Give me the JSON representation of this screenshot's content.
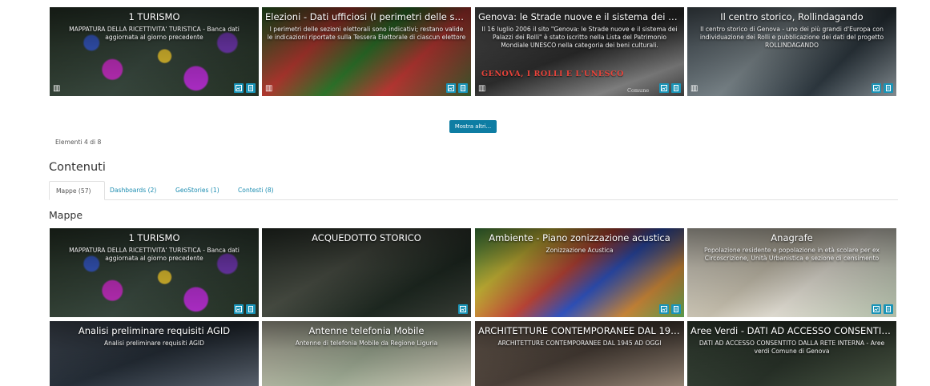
{
  "featured": [
    {
      "title": "1 TURISMO",
      "desc": "MAPPATURA DELLA RICETTIVITA' TURISTICA - Banca dati aggiornata al giorno precedente",
      "theme": "tourism"
    },
    {
      "title": "Elezioni - Dati ufficiosi (I perimetri delle sezioni ...",
      "desc": "I perimetri delle sezioni elettorali sono indicativi; restano valide le indicazioni riportate sulla Tessera Elettorale di ciascun elettore",
      "theme": "elections"
    },
    {
      "title": "Genova: le Strade nuove e il sistema dei Palazzi...",
      "desc": "Il 16 luglio 2006 il sito \"Genova: le Strade nuove e il sistema dei Palazzi dei Rolli\" è stato iscritto nella Lista del Patrimonio Mondiale UNESCO nella categoria dei beni culturali.",
      "theme": "unesco",
      "banner": "GENOVA, I ROLLI E L'UNESCO",
      "banner_sub": "Comune"
    },
    {
      "title": "Il centro storico, Rollindagando",
      "desc": "Il centro storico di Genova - uno dei più grandi d'Europa con individuazione dei Rolli e pubblicazione dei dati del progetto ROLLINDAGANDO",
      "theme": "aerial"
    }
  ],
  "show_more_label": "Mostra altri...",
  "count_label": "Elementi 4 di 8",
  "contents_heading": "Contenuti",
  "tabs": [
    {
      "label": "Mappe (57)",
      "active": true
    },
    {
      "label": "Dashboards (2)",
      "active": false
    },
    {
      "label": "GeoStories (1)",
      "active": false
    },
    {
      "label": "Contesti (8)",
      "active": false
    }
  ],
  "maps_heading": "Mappe",
  "maps_row1": [
    {
      "title": "1 TURISMO",
      "desc": "MAPPATURA DELLA RICETTIVITA' TURISTICA - Banca dati aggiornata al giorno precedente",
      "theme": "tourism"
    },
    {
      "title": "ACQUEDOTTO STORICO",
      "desc": "",
      "theme": "aqueduct"
    },
    {
      "title": "Ambiente - Piano zonizzazione acustica",
      "desc": "Zonizzazione Acustica",
      "theme": "acoustic"
    },
    {
      "title": "Anagrafe",
      "desc": "Popolazione residente e popolazione in età scolare per ex Circoscrizione, Unità Urbanistica e sezione di censimento",
      "theme": "registry"
    }
  ],
  "maps_row2": [
    {
      "title": "Analisi preliminare requisiti AGID",
      "desc": "Analisi preliminare requisiti AGID",
      "theme": "building"
    },
    {
      "title": "Antenne telefonia Mobile",
      "desc": "Antenne di telefonia Mobile da Regione Liguria",
      "theme": "antennas"
    },
    {
      "title": "ARCHITETTURE CONTEMPORANEE DAL 1945 A...",
      "desc": "ARCHITETTURE CONTEMPORANEE DAL 1945 AD OGGI",
      "theme": "architecture"
    },
    {
      "title": "Aree Verdi - DATI AD ACCESSO CONSENTITO D...",
      "desc": "DATI AD ACCESSO CONSENTITO DALLA RETE INTERNA - Aree verdi Comune di Genova",
      "theme": "green"
    }
  ]
}
